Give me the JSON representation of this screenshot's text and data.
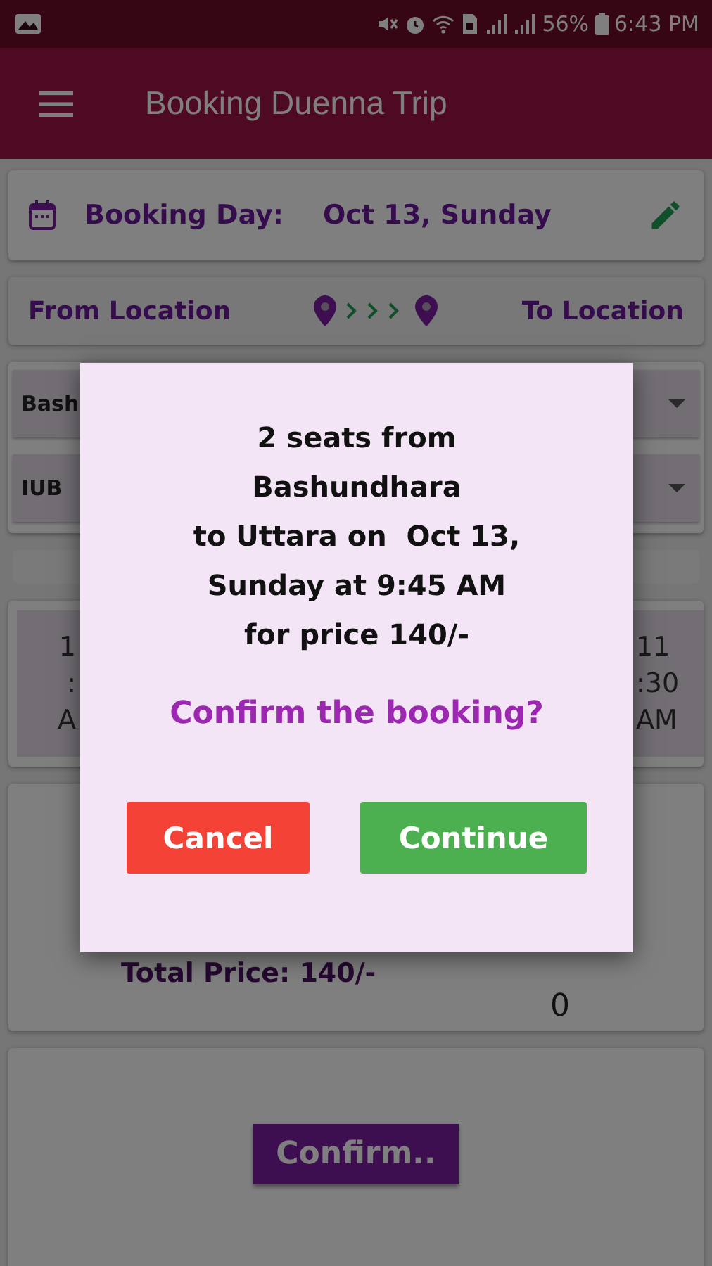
{
  "status_bar": {
    "battery": "56%",
    "time": "6:43 PM"
  },
  "app_bar": {
    "title": "Booking Duenna Trip"
  },
  "booking_day": {
    "label": "Booking Day:",
    "value": "Oct 13, Sunday"
  },
  "route": {
    "from_label": "From Location",
    "to_label": "To Location"
  },
  "dropdowns": [
    {
      "value": "Bash"
    },
    {
      "value": "IUB"
    }
  ],
  "time_slots": [
    {
      "hour": "1",
      "minute": ":",
      "period": "A"
    },
    {
      "hour": "11",
      "minute": ":30",
      "period": "AM"
    }
  ],
  "price": {
    "total": "Total Price: 140/-",
    "count": "0"
  },
  "confirm_button": "Confirm..",
  "dialog": {
    "message": "2 seats from\nBashundhara\nto Uttara on  Oct 13,\nSunday at 9:45 AM\nfor price 140/-",
    "question": "Confirm the booking?",
    "buttons": [
      {
        "label": "Cancel",
        "kind": "cancel"
      },
      {
        "label": "Continue",
        "kind": "continue"
      }
    ]
  }
}
